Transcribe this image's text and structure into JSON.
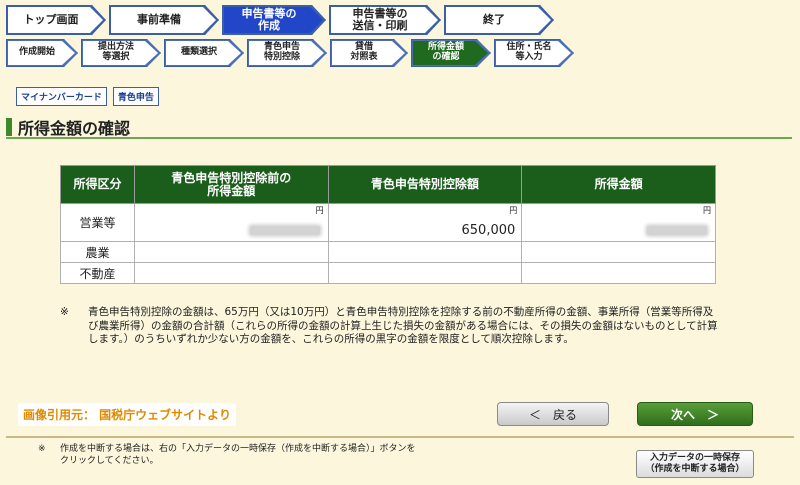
{
  "main_steps": [
    {
      "label": "トップ画面",
      "active": false
    },
    {
      "label": "事前準備",
      "active": false
    },
    {
      "label": "申告書等の\n作成",
      "active": true
    },
    {
      "label": "申告書等の\n送信・印刷",
      "active": false
    },
    {
      "label": "終了",
      "active": false
    }
  ],
  "sub_steps": [
    {
      "label": "作成開始",
      "active": false
    },
    {
      "label": "提出方法\n等選択",
      "active": false
    },
    {
      "label": "種類選択",
      "active": false
    },
    {
      "label": "青色申告\n特別控除",
      "active": false
    },
    {
      "label": "貸借\n対照表",
      "active": false
    },
    {
      "label": "所得金額\nの確認",
      "active": true
    },
    {
      "label": "住所・氏名\n等入力",
      "active": false
    }
  ],
  "tags": {
    "mynumber": "マイナンバーカード",
    "blue": "青色申告"
  },
  "section_title": "所得金額の確認",
  "table": {
    "headers": [
      "所得区分",
      "青色申告特別控除前の\n所得金額",
      "青色申告特別控除額",
      "所得金額"
    ],
    "unit": "円",
    "rows": [
      {
        "category": "営業等",
        "before": "",
        "deduction": "650,000",
        "income": ""
      },
      {
        "category": "農業",
        "before": "",
        "deduction": "",
        "income": ""
      },
      {
        "category": "不動産",
        "before": "",
        "deduction": "",
        "income": ""
      }
    ]
  },
  "note": {
    "mark": "※",
    "text": "青色申告特別控除の金額は、65万円（又は10万円）と青色申告特別控除を控除する前の不動産所得の金額、事業所得（営業等所得及び農業所得）の金額の合計額（これらの所得の金額の計算上生じた損失の金額がある場合には、その損失の金額はないものとして計算します。）のうちいずれか少ない方の金額を、これらの所得の黒字の金額を限度として順次控除します。"
  },
  "source_caption": "画像引用元： 国税庁ウェブサイトより",
  "buttons": {
    "back": "＜　戻る",
    "next": "次へ　＞",
    "save": "入力データの一時保存\n（作成を中断する場合）"
  },
  "footer_note": {
    "mark": "※",
    "text": "作成を中断する場合は、右の「入力データの一時保存（作成を中断する場合）」ボタンをクリックしてください。"
  },
  "colors": {
    "background": "#fbf6dc",
    "active_main_step": "#2146c7",
    "active_sub_step": "#1f6a1f",
    "table_header": "#1b5e1b",
    "next_button": "#3f8a2a",
    "caption": "#e08a00"
  }
}
